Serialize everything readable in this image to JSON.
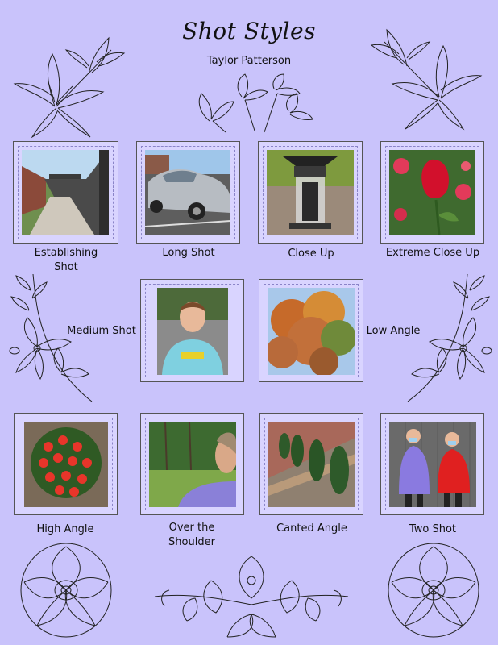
{
  "header": {
    "title": "Shot Styles",
    "author": "Taylor Patterson"
  },
  "shots": [
    {
      "label": "Establishing Shot",
      "icon": "hallway-photo"
    },
    {
      "label": "Long Shot",
      "icon": "car-photo"
    },
    {
      "label": "Close Up",
      "icon": "bird-feeder-photo"
    },
    {
      "label": "Extreme Close Up",
      "icon": "rose-photo"
    },
    {
      "label": "Medium Shot",
      "icon": "portrait-photo"
    },
    {
      "label": "Low Angle",
      "icon": "tree-photo"
    },
    {
      "label": "High Angle",
      "icon": "flower-bush-photo"
    },
    {
      "label": "Over the Shoulder",
      "icon": "shoulder-photo"
    },
    {
      "label": "Canted Angle",
      "icon": "shrubs-photo"
    },
    {
      "label": "Two Shot",
      "icon": "two-people-photo"
    }
  ],
  "colors": {
    "background": "#c9c3fb",
    "frame_fill": "#d9d4ff",
    "line_art": "#222222"
  }
}
